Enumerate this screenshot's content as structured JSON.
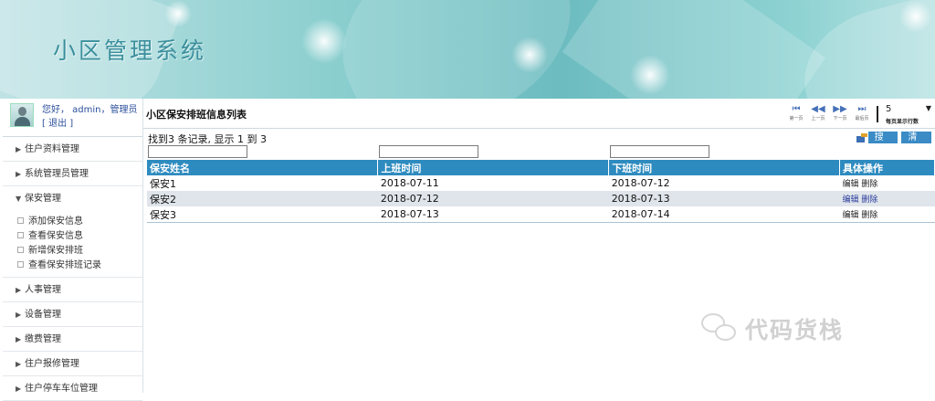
{
  "header": {
    "title": "小区管理系统"
  },
  "user": {
    "greeting": "您好， admin，管理员",
    "logout": "[ 退出 ]"
  },
  "sidebar": {
    "items_before": [
      {
        "label": "住户资料管理"
      },
      {
        "label": "系统管理员管理"
      }
    ],
    "expanded": {
      "label": "保安管理",
      "children": [
        "添加保安信息",
        "查看保安信息",
        "新增保安排班",
        "查看保安排班记录"
      ]
    },
    "items_after": [
      {
        "label": "人事管理"
      },
      {
        "label": "设备管理"
      },
      {
        "label": "缴费管理"
      },
      {
        "label": "住户报修管理"
      },
      {
        "label": "住户停车车位管理"
      }
    ]
  },
  "main": {
    "list_title": "小区保安排班信息列表",
    "record_info": "找到3 条记录, 显示 1 到 3",
    "buttons": {
      "search": "搜索",
      "clear": "清除"
    },
    "pager": {
      "first": "第一页",
      "prev": "上一页",
      "next": "下一页",
      "last": "最后页",
      "page_size": "5",
      "page_size_label": "每页显示行数"
    },
    "columns": [
      "保安姓名",
      "上班时间",
      "下班时间",
      "具体操作"
    ],
    "rows": [
      {
        "name": "保安1",
        "start": "2018-07-11",
        "end": "2018-07-12",
        "ops": "编辑 删除"
      },
      {
        "name": "保安2",
        "start": "2018-07-12",
        "end": "2018-07-13",
        "ops": "编辑 删除"
      },
      {
        "name": "保安3",
        "start": "2018-07-13",
        "end": "2018-07-14",
        "ops": "编辑 删除"
      }
    ]
  },
  "watermark": {
    "text": "代码货栈",
    "icon": "wechat-icon"
  },
  "colors": {
    "table_header": "#2e8bbf",
    "alt_row": "#dfe5ea",
    "link": "#2c4f9c",
    "title": "#3b8f9d"
  }
}
